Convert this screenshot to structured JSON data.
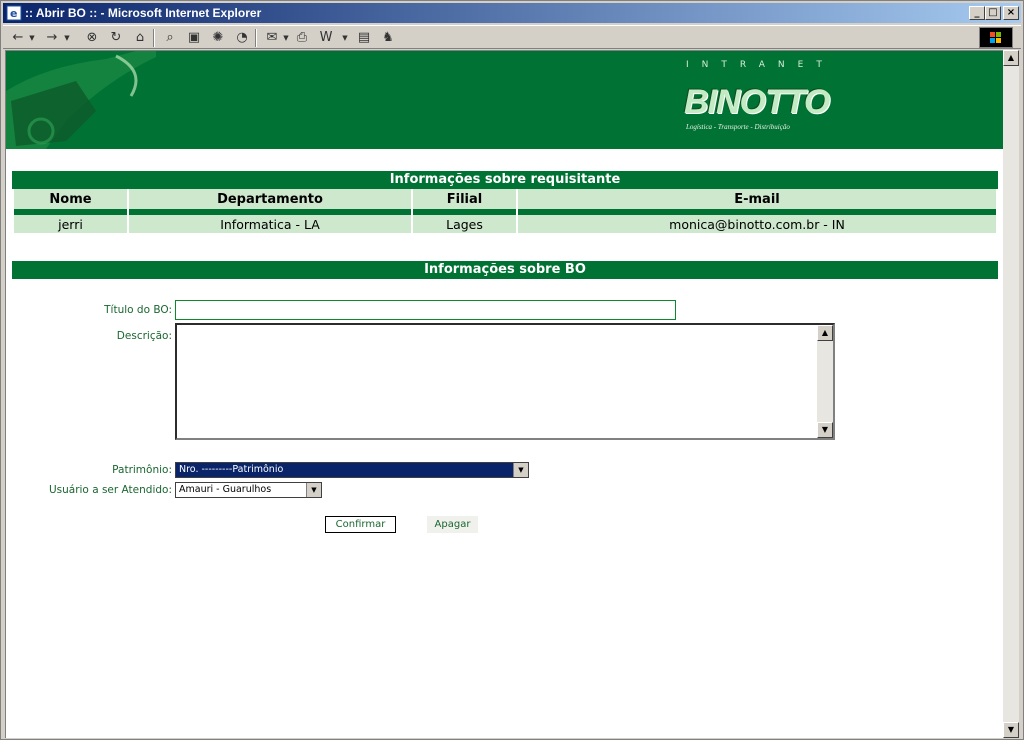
{
  "window": {
    "title": ":: Abrir BO :: - Microsoft Internet Explorer",
    "min": "_",
    "max": "□",
    "close": "×"
  },
  "toolbar": {
    "icons": [
      "back-icon",
      "forward-icon",
      "stop-icon",
      "refresh-icon",
      "home-icon",
      "search-icon",
      "favorites-icon",
      "media-icon",
      "history-icon",
      "mail-icon",
      "print-icon",
      "edit-icon",
      "discuss-icon",
      "messenger-icon"
    ]
  },
  "banner": {
    "intranet": "INTRANET",
    "brand": "BINOTTO",
    "tagline": "Logística - Transporte - Distribuição",
    "bg_color": "#007233"
  },
  "requisitante": {
    "heading": "Informações sobre requisitante",
    "columns": [
      "Nome",
      "Departamento",
      "Filial",
      "E-mail"
    ],
    "row": [
      "jerri",
      "Informatica - LA",
      "Lages",
      "monica@binotto.com.br - IN"
    ]
  },
  "bo": {
    "heading": "Informações sobre BO",
    "titulo_label": "Título do BO:",
    "titulo_value": "",
    "descricao_label": "Descrição:",
    "patrimonio_label": "Patrimônio:",
    "patrimonio_value": "Nro. ---------Patrimônio",
    "usuario_label": "Usuário a ser Atendido:",
    "usuario_value": "Amauri - Guarulhos",
    "confirmar": "Confirmar",
    "apagar": "Apagar"
  }
}
